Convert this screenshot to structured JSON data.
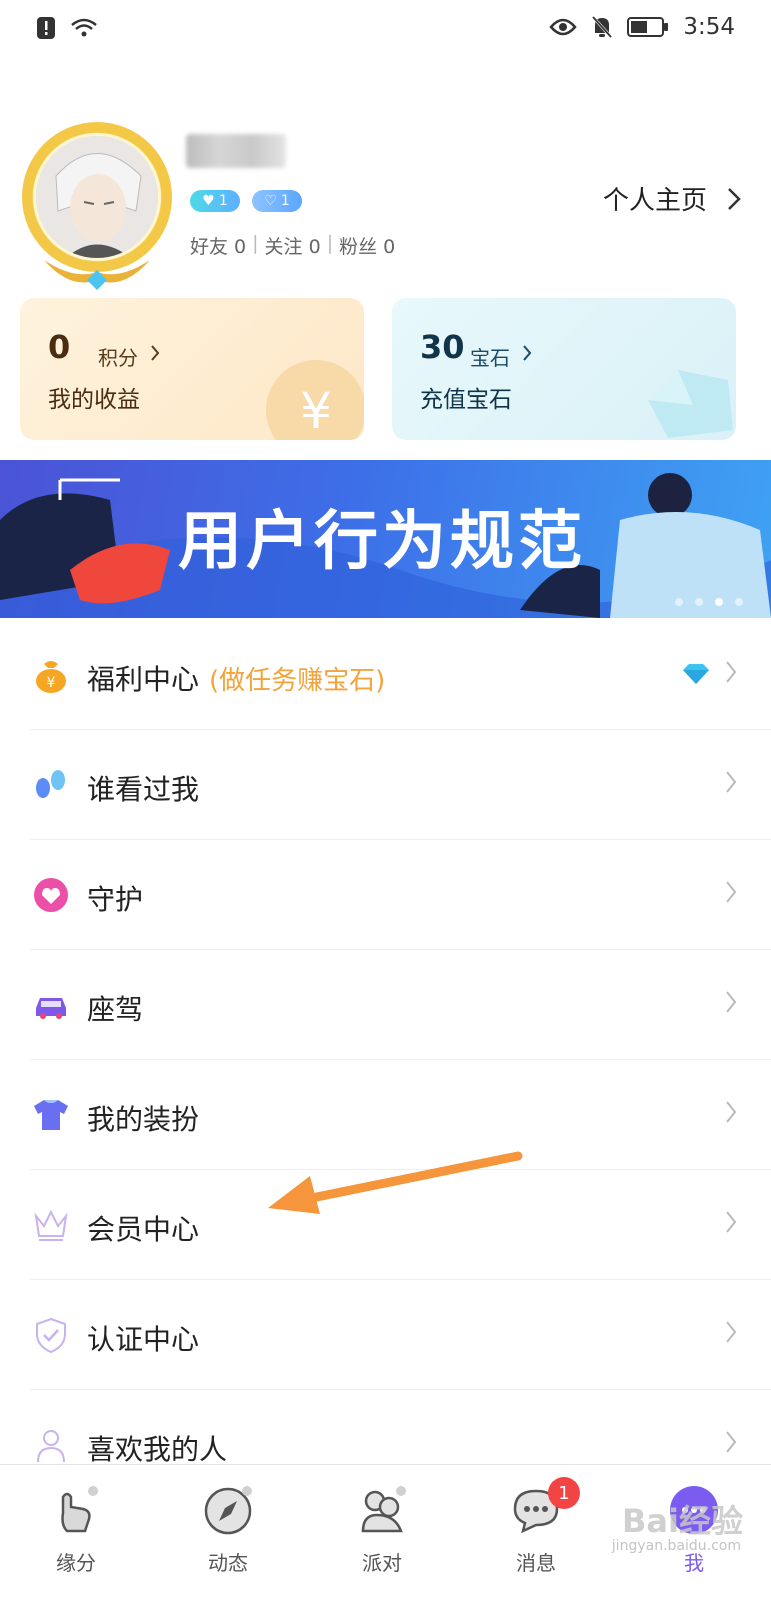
{
  "status_bar": {
    "time": "3:54"
  },
  "profile": {
    "badge1": "1",
    "badge2": "1",
    "social": {
      "friends": "好友 0",
      "following": "关注 0",
      "fans": "粉丝 0"
    },
    "homepage_label": "个人主页"
  },
  "cards": {
    "points": {
      "value": "0",
      "unit": "积分",
      "label": "我的收益"
    },
    "gems": {
      "value": "30",
      "unit": "宝石",
      "label": "充值宝石"
    }
  },
  "banner": {
    "title": "用户行为规范",
    "page_count": 4,
    "active_page": 3
  },
  "menu": {
    "items": [
      {
        "label": "福利中心",
        "hint": "(做任务赚宝石)"
      },
      {
        "label": "谁看过我"
      },
      {
        "label": "守护"
      },
      {
        "label": "座驾"
      },
      {
        "label": "我的装扮"
      },
      {
        "label": "会员中心"
      },
      {
        "label": "认证中心"
      },
      {
        "label": "喜欢我的人"
      }
    ]
  },
  "tabbar": {
    "tabs": [
      {
        "label": "缘分"
      },
      {
        "label": "动态"
      },
      {
        "label": "派对"
      },
      {
        "label": "消息",
        "badge": "1"
      },
      {
        "label": "我"
      }
    ]
  },
  "watermark": {
    "text": "Bai经验",
    "sub": "jingyan.baidu.com"
  },
  "colors": {
    "accent": "#7b5bf0",
    "hint": "#f3a33a",
    "annotation_arrow": "#f5953c"
  }
}
